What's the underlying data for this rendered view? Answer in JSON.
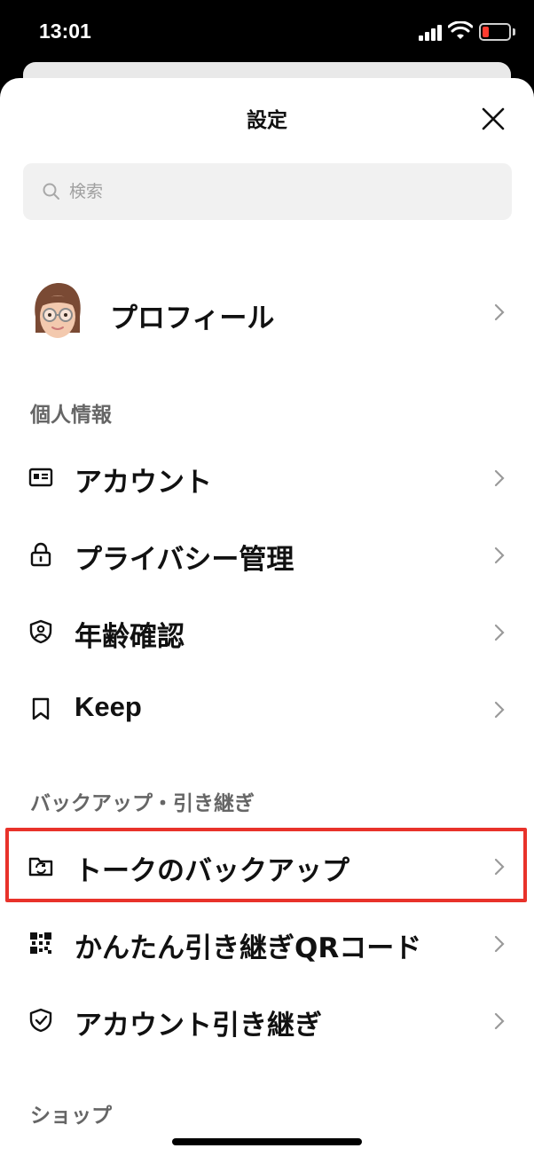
{
  "status_bar": {
    "time": "13:01"
  },
  "header": {
    "title": "設定"
  },
  "search": {
    "placeholder": "検索"
  },
  "profile": {
    "label": "プロフィール"
  },
  "sections": {
    "personal": "個人情報",
    "backup": "バックアップ・引き継ぎ",
    "shop": "ショップ"
  },
  "items": {
    "account": "アカウント",
    "privacy": "プライバシー管理",
    "age": "年齢確認",
    "keep": "Keep",
    "talk_backup": "トークのバックアップ",
    "qr_transfer": "かんたん引き継ぎQRコード",
    "account_transfer": "アカウント引き継ぎ"
  },
  "colors": {
    "highlight": "#e8322a",
    "battery_low": "#ff3b30"
  }
}
